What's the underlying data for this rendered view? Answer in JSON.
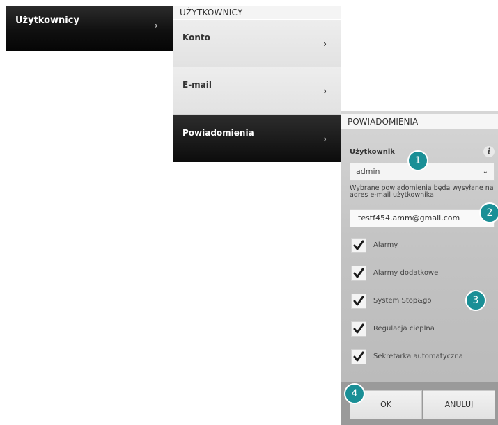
{
  "menu": {
    "item": {
      "label": "Użytkownicy",
      "chevron": "›"
    }
  },
  "users_panel": {
    "title": "UŻYTKOWNICY",
    "items": [
      {
        "label": "Konto",
        "chevron": "›"
      },
      {
        "label": "E-mail",
        "chevron": "›"
      },
      {
        "label": "Powiadomienia",
        "chevron": "›"
      }
    ]
  },
  "notifications": {
    "title": "POWIADOMIENIA",
    "user_label": "Użytkownik",
    "info_icon": "i",
    "user_select": {
      "value": "admin",
      "dropdown_icon": "⌄"
    },
    "hint": "Wybrane powiadomienia będą wysyłane na adres e-mail użytkownika",
    "email": "testf454.amm@gmail.com",
    "checkboxes": [
      {
        "label": "Alarmy",
        "checked": true
      },
      {
        "label": "Alarmy dodatkowe",
        "checked": true
      },
      {
        "label": "System Stop&go",
        "checked": true
      },
      {
        "label": "Regulacja cieplna",
        "checked": true
      },
      {
        "label": "Sekretarka automatyczna",
        "checked": true
      }
    ],
    "ok_label": "OK",
    "cancel_label": "ANULUJ"
  },
  "callouts": [
    "1",
    "2",
    "3",
    "4"
  ],
  "colors": {
    "callout": "#1a8f96",
    "active_item": "#0c0c0c"
  }
}
